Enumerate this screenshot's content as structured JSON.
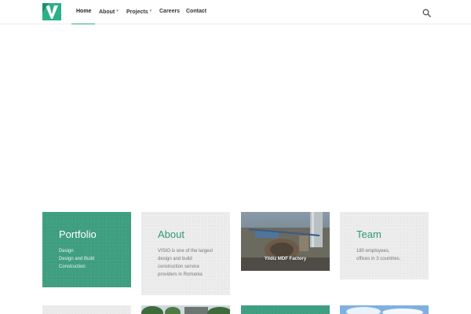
{
  "header": {
    "logo_letter": "V",
    "brand_color": "#2bb08a",
    "nav": {
      "home": "Home",
      "about": "About",
      "projects": "Projects",
      "careers": "Careers",
      "contact": "Contact"
    },
    "active_item": "Home",
    "search_icon": "search-icon"
  },
  "cards": {
    "portfolio": {
      "title": "Portfolio",
      "lines": [
        "Design",
        "Design and Build",
        "Construction"
      ]
    },
    "about": {
      "title": "About",
      "lines": [
        "VISIO is one of the largest",
        "design and build",
        "construction service",
        "providers in Romania"
      ]
    },
    "project": {
      "caption": "Yildiz MDF Factory"
    },
    "team": {
      "title": "Team",
      "lines": [
        "180 employees,",
        "offices in 3 countries."
      ]
    }
  },
  "colors": {
    "accent_green": "#3f9f80",
    "card_grey": "#ececec",
    "title_green": "#2f9b79"
  }
}
